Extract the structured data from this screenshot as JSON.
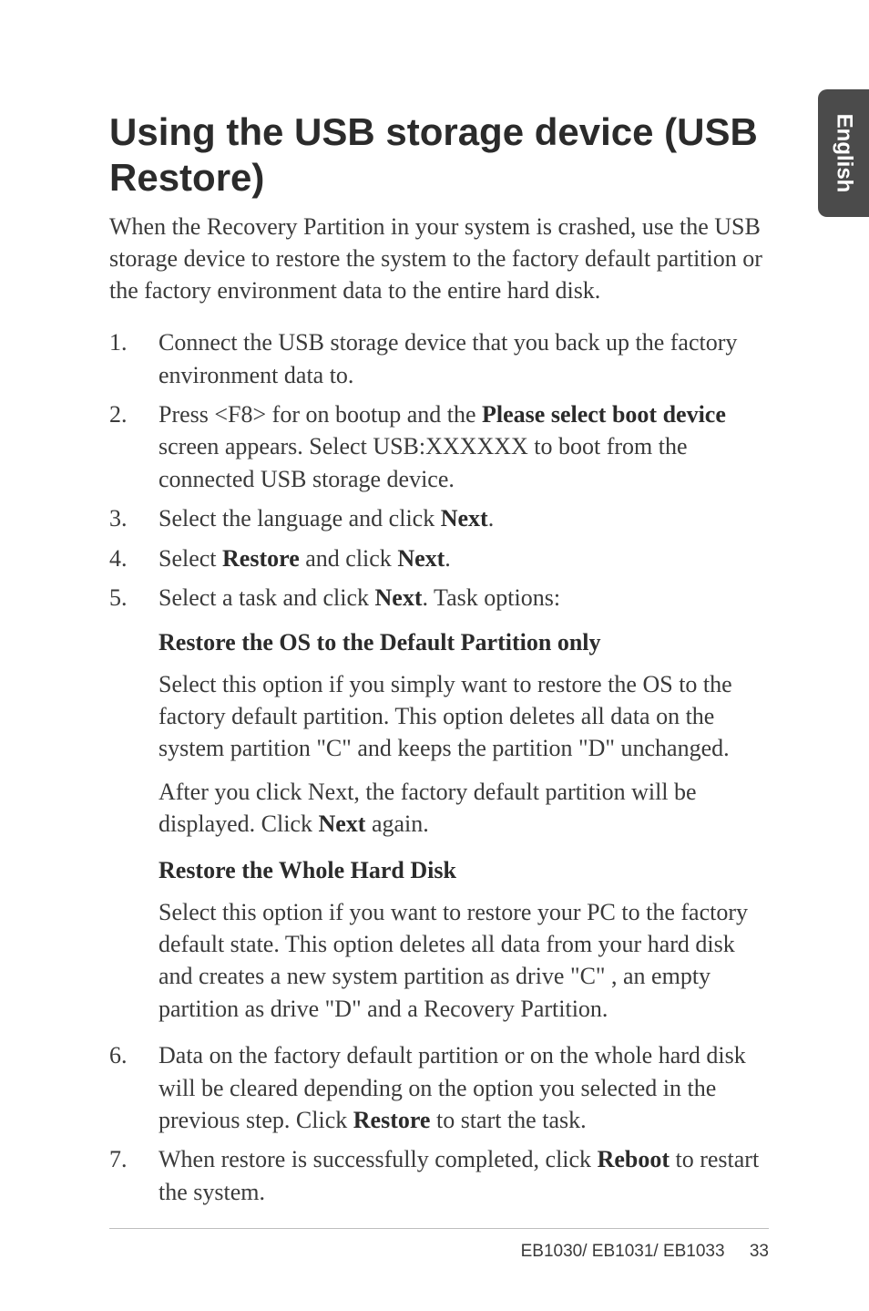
{
  "side_tab": "English",
  "title": "Using the USB storage device (USB Restore)",
  "intro": "When the Recovery Partition in your system is crashed, use the USB storage device to restore the system to the factory default partition or the factory environment data to the entire hard disk.",
  "steps": {
    "s1": {
      "num": "1.",
      "text": "Connect the USB storage device that you back up the factory environment data to."
    },
    "s2": {
      "num": "2.",
      "pre": "Press <F8> for on bootup and the ",
      "bold": "Please select boot device",
      "post": " screen appears. Select USB:XXXXXX to boot from the connected USB storage device."
    },
    "s3": {
      "num": "3.",
      "pre": "Select the language and click ",
      "bold": "Next",
      "post": "."
    },
    "s4": {
      "num": "4.",
      "pre": "Select ",
      "bold1": "Restore",
      "mid": " and click ",
      "bold2": "Next",
      "post": "."
    },
    "s5": {
      "num": "5.",
      "pre": "Select a task and click ",
      "bold": "Next",
      "post": ". Task options:"
    },
    "s6": {
      "num": "6.",
      "pre": "Data on the factory default partition or on the whole hard disk will be cleared depending on the option you selected in the previous step. Click ",
      "bold": "Restore",
      "post": " to start the task."
    },
    "s7": {
      "num": "7.",
      "pre": "When restore is successfully completed, click ",
      "bold": "Reboot",
      "post": " to restart the system."
    }
  },
  "sub": {
    "a": {
      "heading": "Restore the OS to the Default Partition only",
      "p1": "Select this option if you simply want to restore the OS to the factory default partition. This option deletes all data on the system partition \"C\" and keeps the partition \"D\" unchanged.",
      "p2_pre": "After you click Next, the factory default partition will be displayed. Click ",
      "p2_bold": "Next",
      "p2_post": " again."
    },
    "b": {
      "heading": "Restore the Whole Hard Disk",
      "p1": "Select this option if you want to restore your PC to the factory default state. This option deletes all data from your hard disk and creates a new system partition as drive \"C\" , an empty partition as drive \"D\" and a Recovery Partition."
    }
  },
  "footer": {
    "model": "EB1030/ EB1031/ EB1033",
    "page": "33"
  }
}
